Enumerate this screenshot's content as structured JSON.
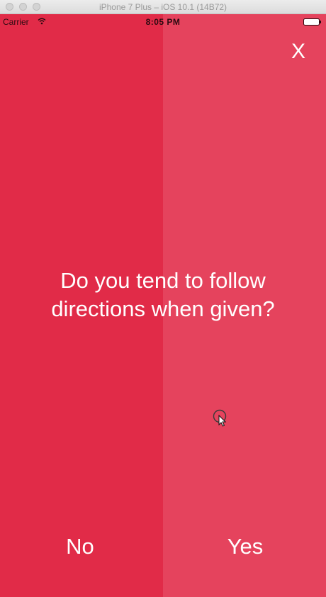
{
  "window": {
    "title": "iPhone 7 Plus – iOS 10.1 (14B72)"
  },
  "status_bar": {
    "carrier": "Carrier",
    "time": "8:05 PM"
  },
  "close_label": "X",
  "question": "Do you tend to follow directions when given?",
  "answers": {
    "no": "No",
    "yes": "Yes"
  },
  "colors": {
    "no_panel": "#e12b48",
    "yes_panel": "#e5435d",
    "text": "#ffffff"
  },
  "icons": [
    "wifi-icon",
    "battery-icon",
    "cursor-icon"
  ]
}
